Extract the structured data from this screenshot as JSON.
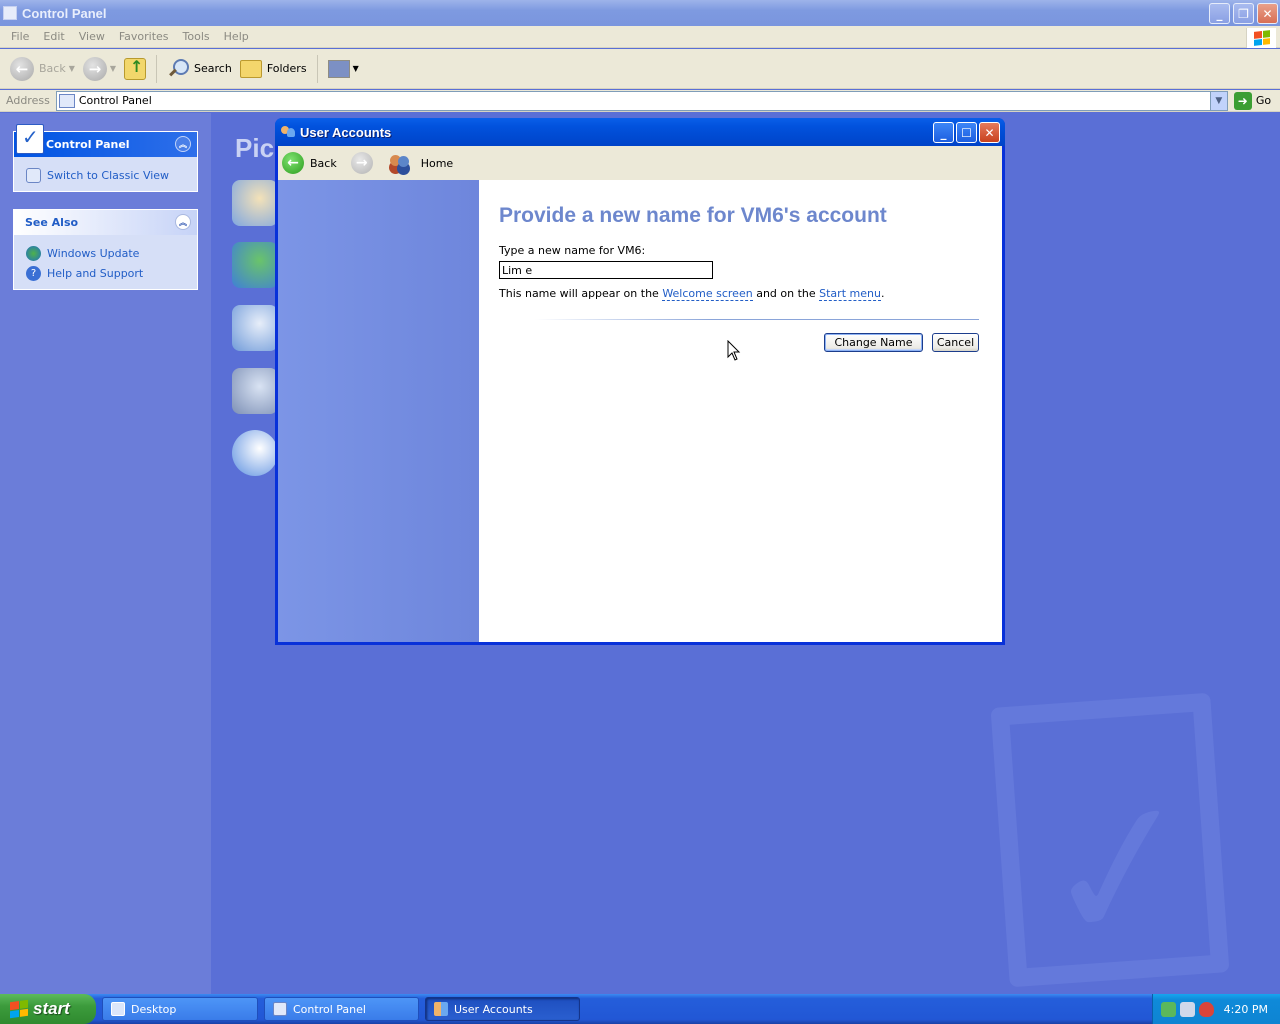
{
  "control_panel": {
    "title": "Control Panel",
    "menu": [
      "File",
      "Edit",
      "View",
      "Favorites",
      "Tools",
      "Help"
    ],
    "toolbar": {
      "back_label": "Back",
      "search_label": "Search",
      "folders_label": "Folders"
    },
    "address": {
      "label": "Address",
      "value": "Control Panel",
      "go_label": "Go"
    },
    "task_pane": {
      "main_panel": {
        "title": "Control Panel",
        "link": "Switch to Classic View"
      },
      "see_also": {
        "title": "See Also",
        "links": [
          "Windows Update",
          "Help and Support"
        ]
      }
    },
    "category_title_partial": "Pic"
  },
  "dialog": {
    "title": "User Accounts",
    "nav": {
      "back_label": "Back",
      "home_label": "Home"
    },
    "heading": "Provide a new name for VM6's account",
    "field_label": "Type a new name for VM6:",
    "input_value": "Lim e",
    "hint": {
      "prefix": "This name will appear on the ",
      "link1": "Welcome screen",
      "middle": " and on the ",
      "link2": "Start menu",
      "suffix": "."
    },
    "buttons": {
      "change_name": "Change Name",
      "cancel": "Cancel"
    }
  },
  "taskbar": {
    "start_label": "start",
    "tasks": [
      {
        "label": "Desktop",
        "active": false
      },
      {
        "label": "Control Panel",
        "active": false
      },
      {
        "label": "User Accounts",
        "active": true
      }
    ],
    "clock": "4:20 PM"
  },
  "icons": {
    "caption_minimize": "minimize-icon",
    "caption_maximize": "maximize-icon",
    "caption_restore": "restore-icon",
    "caption_close": "close-icon",
    "windows_flag": "windows-flag-icon"
  },
  "colors": {
    "desktop_bg": "#5a6fd6",
    "dialog_title_blue": "#0054e3",
    "heading_blue": "#6d87cd",
    "link_blue": "#215dc6",
    "start_green": "#3c9b3c"
  }
}
